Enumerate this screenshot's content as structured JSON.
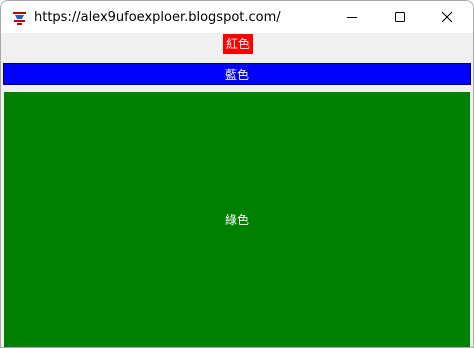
{
  "window": {
    "title": "https://alex9ufoexploer.blogspot.com/",
    "icon": "tk-feather-icon",
    "buttons": [
      "minimize-icon",
      "maximize-icon",
      "close-icon"
    ]
  },
  "labels": {
    "red": "紅色",
    "blue": "藍色",
    "green": "綠色"
  },
  "colors": {
    "red": "#ff0000",
    "blue": "#0000ff",
    "green": "#008000",
    "client_bg": "#f0f0f0"
  }
}
